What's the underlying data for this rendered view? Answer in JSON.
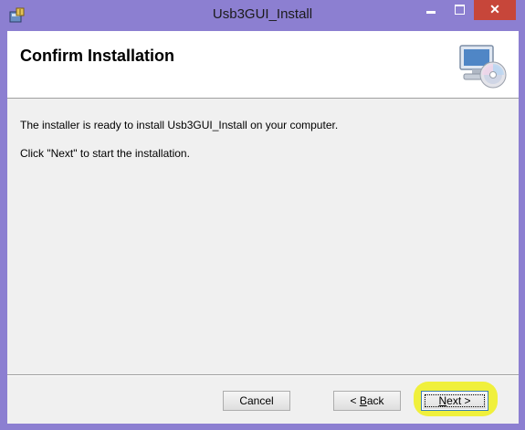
{
  "window": {
    "title": "Usb3GUI_Install",
    "close_glyph": "✕",
    "controls": [
      "minimize-icon",
      "maximize-icon",
      "close-icon"
    ],
    "app_icon": "installer-icon"
  },
  "header": {
    "title": "Confirm Installation",
    "icon": "computer-cd-icon"
  },
  "body": {
    "line1": "The installer is ready to install Usb3GUI_Install on your computer.",
    "line2": "Click \"Next\" to start the installation."
  },
  "buttons": {
    "cancel": "Cancel",
    "back_mnemonic": "B",
    "back_prefix": "< ",
    "back_rest": "ack",
    "next_mnemonic": "N",
    "next_rest": "ext >"
  },
  "colors": {
    "titlebar": "#8c7fd1",
    "close_button": "#c7463a",
    "highlight": "#f0f000"
  }
}
